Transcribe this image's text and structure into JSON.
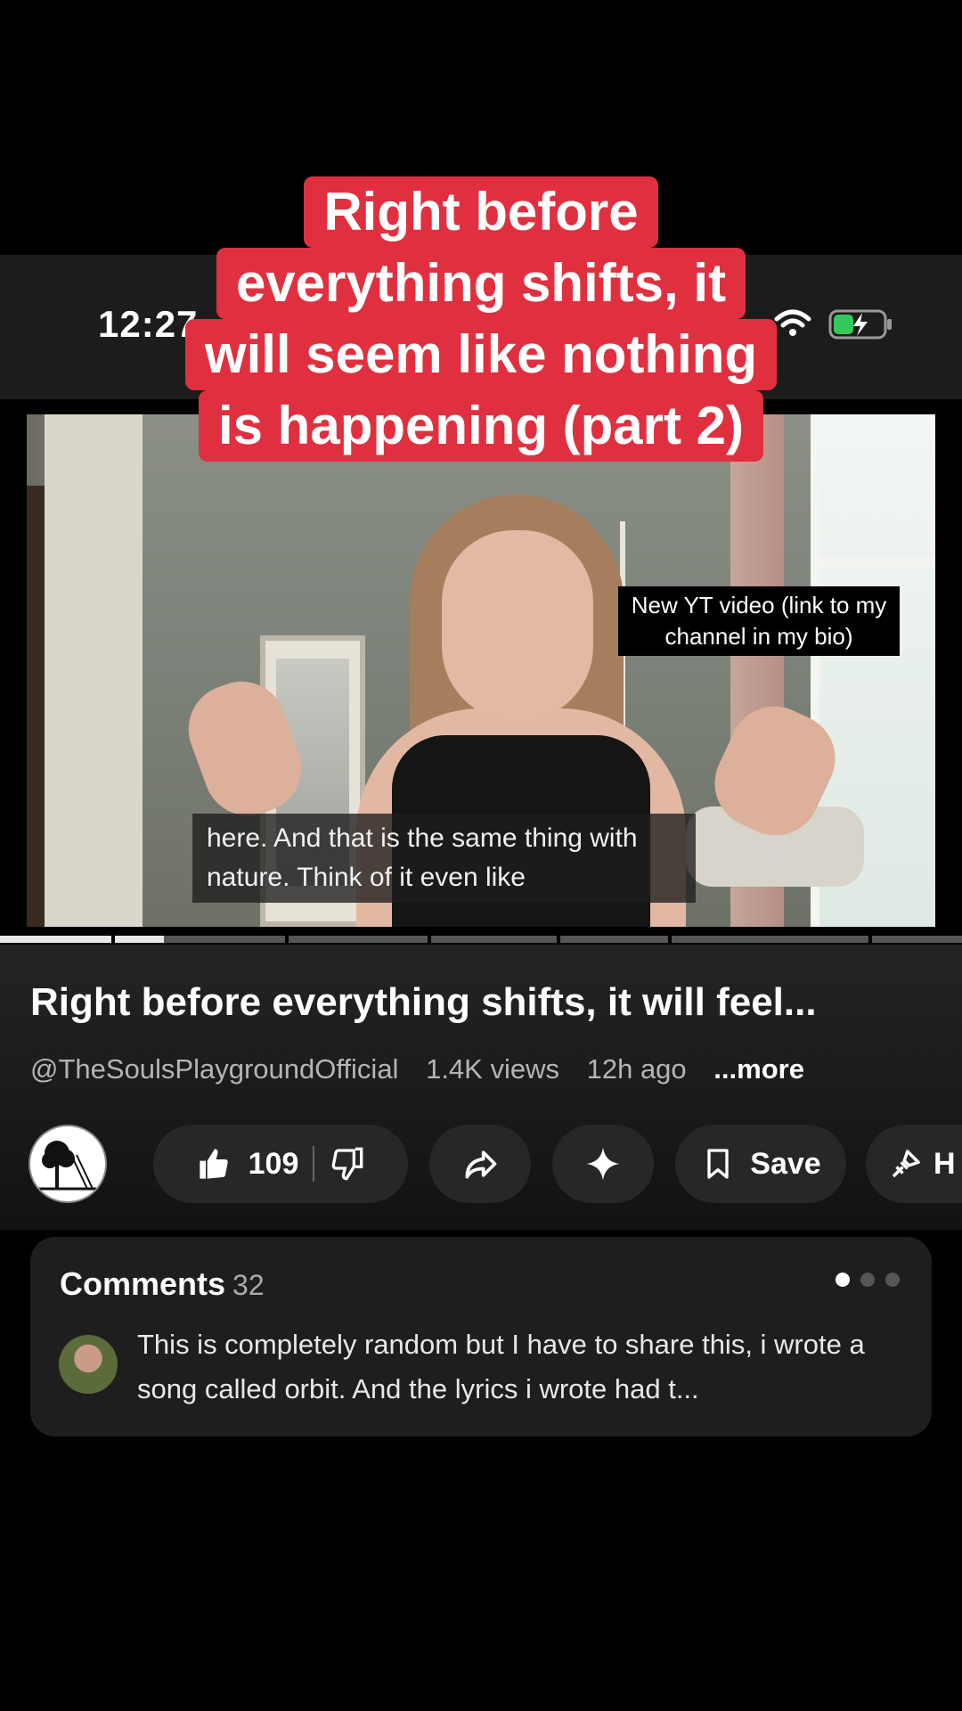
{
  "overlay": {
    "title_lines": [
      "Right before",
      "everything shifts, it",
      "will seem like nothing",
      "is happening (part 2)"
    ]
  },
  "status_bar": {
    "time": "12:27"
  },
  "video": {
    "tag_text": "New YT video (link to my channel in my bio)",
    "captions": "here. And that is the same thing with nature. Think of it even like",
    "progress_fraction": 0.17
  },
  "details": {
    "title": "Right before everything shifts, it will feel...",
    "channel": "@TheSoulsPlaygroundOfficial",
    "views": "1.4K views",
    "age": "12h ago",
    "more": "...more"
  },
  "actions": {
    "like_count": "109",
    "save_label": "Save",
    "extra_label": "H"
  },
  "comments": {
    "label": "Comments",
    "count": "32",
    "top_comment": "This is completely random but I have to share this, i wrote a song called orbit. And the lyrics i wrote had t..."
  },
  "colors": {
    "accent_red": "#e0303f",
    "battery_green": "#34c759"
  }
}
